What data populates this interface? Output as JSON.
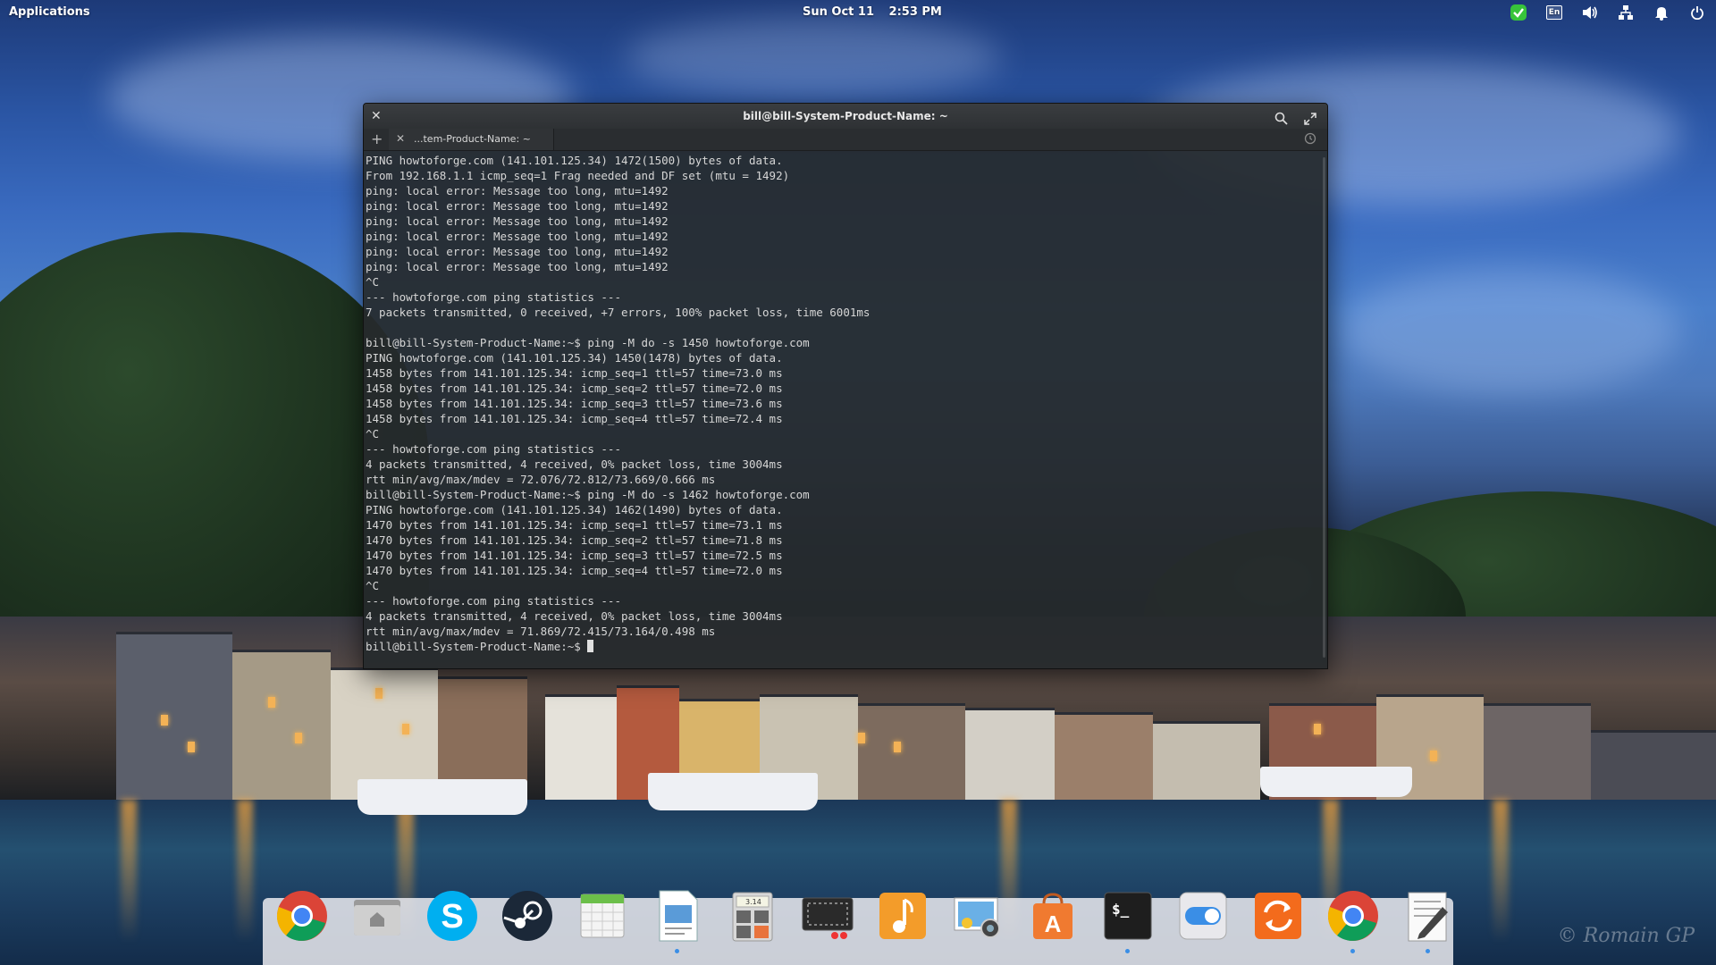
{
  "panel": {
    "applications_label": "Applications",
    "date": "Sun Oct 11",
    "time": "2:53 PM",
    "tray": {
      "keyboard_layout": "En",
      "icons": [
        "update-check-icon",
        "keyboard-layout-icon",
        "volume-icon",
        "network-icon",
        "notifications-icon",
        "power-icon"
      ]
    }
  },
  "terminal": {
    "title": "bill@bill-System-Product-Name: ~",
    "tab_label": "...tem-Product-Name: ~",
    "output": "PING howtoforge.com (141.101.125.34) 1472(1500) bytes of data.\nFrom 192.168.1.1 icmp_seq=1 Frag needed and DF set (mtu = 1492)\nping: local error: Message too long, mtu=1492\nping: local error: Message too long, mtu=1492\nping: local error: Message too long, mtu=1492\nping: local error: Message too long, mtu=1492\nping: local error: Message too long, mtu=1492\nping: local error: Message too long, mtu=1492\n^C\n--- howtoforge.com ping statistics ---\n7 packets transmitted, 0 received, +7 errors, 100% packet loss, time 6001ms\n\nbill@bill-System-Product-Name:~$ ping -M do -s 1450 howtoforge.com\nPING howtoforge.com (141.101.125.34) 1450(1478) bytes of data.\n1458 bytes from 141.101.125.34: icmp_seq=1 ttl=57 time=73.0 ms\n1458 bytes from 141.101.125.34: icmp_seq=2 ttl=57 time=72.0 ms\n1458 bytes from 141.101.125.34: icmp_seq=3 ttl=57 time=73.6 ms\n1458 bytes from 141.101.125.34: icmp_seq=4 ttl=57 time=72.4 ms\n^C\n--- howtoforge.com ping statistics ---\n4 packets transmitted, 4 received, 0% packet loss, time 3004ms\nrtt min/avg/max/mdev = 72.076/72.812/73.669/0.666 ms\nbill@bill-System-Product-Name:~$ ping -M do -s 1462 howtoforge.com\nPING howtoforge.com (141.101.125.34) 1462(1490) bytes of data.\n1470 bytes from 141.101.125.34: icmp_seq=1 ttl=57 time=73.1 ms\n1470 bytes from 141.101.125.34: icmp_seq=2 ttl=57 time=71.8 ms\n1470 bytes from 141.101.125.34: icmp_seq=3 ttl=57 time=72.5 ms\n1470 bytes from 141.101.125.34: icmp_seq=4 ttl=57 time=72.0 ms\n^C\n--- howtoforge.com ping statistics ---\n4 packets transmitted, 4 received, 0% packet loss, time 3004ms\nrtt min/avg/max/mdev = 71.869/72.415/73.164/0.498 ms\n",
    "prompt": "bill@bill-System-Product-Name:~$ "
  },
  "dock": {
    "items": [
      {
        "name": "chrome-icon",
        "running": false
      },
      {
        "name": "files-icon",
        "running": false
      },
      {
        "name": "skype-icon",
        "running": false
      },
      {
        "name": "steam-icon",
        "running": false
      },
      {
        "name": "calendar-icon",
        "running": false
      },
      {
        "name": "document-viewer-icon",
        "running": true
      },
      {
        "name": "calculator-icon",
        "running": false
      },
      {
        "name": "screenshot-icon",
        "running": false
      },
      {
        "name": "music-icon",
        "running": false
      },
      {
        "name": "photos-icon",
        "running": false
      },
      {
        "name": "app-center-icon",
        "running": false
      },
      {
        "name": "terminal-icon",
        "running": true
      },
      {
        "name": "switchboard-icon",
        "running": false
      },
      {
        "name": "software-update-icon",
        "running": false
      },
      {
        "name": "chrome-icon",
        "running": true
      },
      {
        "name": "text-editor-icon",
        "running": true
      }
    ],
    "calculator_display": "3.14"
  },
  "wallpaper_signature": "© Romain GP",
  "colors": {
    "accent_blue": "#3a8ee6",
    "update_green": "#37c43a"
  }
}
